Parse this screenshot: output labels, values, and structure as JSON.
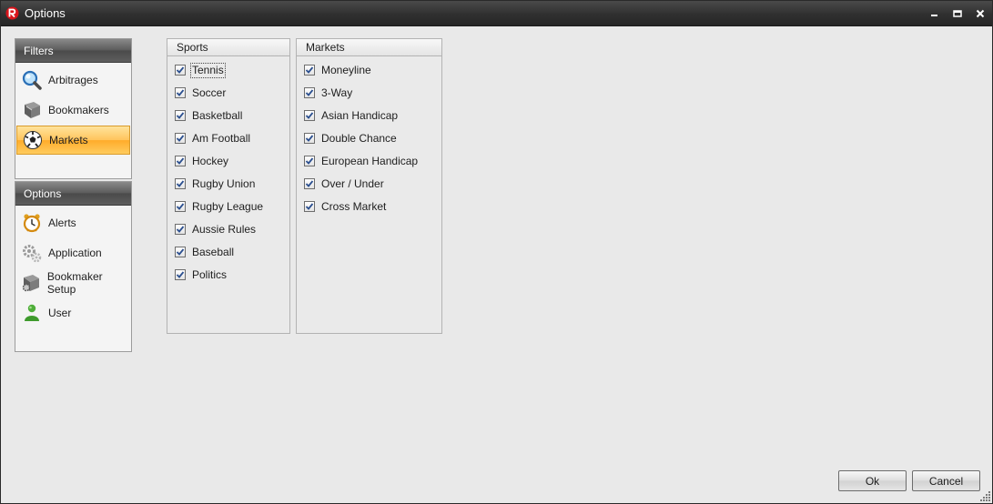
{
  "window": {
    "title": "Options"
  },
  "filters": {
    "header": "Filters",
    "items": [
      {
        "label": "Arbitrages",
        "icon": "magnifier-icon"
      },
      {
        "label": "Bookmakers",
        "icon": "book-icon"
      },
      {
        "label": "Markets",
        "icon": "soccer-ball-icon",
        "selected": true
      }
    ]
  },
  "options": {
    "header": "Options",
    "items": [
      {
        "label": "Alerts",
        "icon": "alarm-clock-icon"
      },
      {
        "label": "Application",
        "icon": "gears-icon"
      },
      {
        "label": "Bookmaker Setup",
        "icon": "book-gear-icon"
      },
      {
        "label": "User",
        "icon": "user-icon"
      }
    ]
  },
  "sports": {
    "header": "Sports",
    "items": [
      {
        "label": "Tennis",
        "checked": true
      },
      {
        "label": "Soccer",
        "checked": true
      },
      {
        "label": "Basketball",
        "checked": true
      },
      {
        "label": "Am Football",
        "checked": true
      },
      {
        "label": "Hockey",
        "checked": true
      },
      {
        "label": "Rugby Union",
        "checked": true
      },
      {
        "label": "Rugby League",
        "checked": true
      },
      {
        "label": "Aussie Rules",
        "checked": true
      },
      {
        "label": "Baseball",
        "checked": true
      },
      {
        "label": "Politics",
        "checked": true
      }
    ]
  },
  "markets": {
    "header": "Markets",
    "items": [
      {
        "label": "Moneyline",
        "checked": true
      },
      {
        "label": "3-Way",
        "checked": true
      },
      {
        "label": "Asian Handicap",
        "checked": true
      },
      {
        "label": "Double Chance",
        "checked": true
      },
      {
        "label": "European Handicap",
        "checked": true
      },
      {
        "label": "Over / Under",
        "checked": true
      },
      {
        "label": "Cross Market",
        "checked": true
      }
    ]
  },
  "buttons": {
    "ok": "Ok",
    "cancel": "Cancel"
  },
  "colors": {
    "selected_nav": "#ffc45c",
    "header_dark": "#5a5a5a",
    "logo_red": "#d8141b"
  }
}
